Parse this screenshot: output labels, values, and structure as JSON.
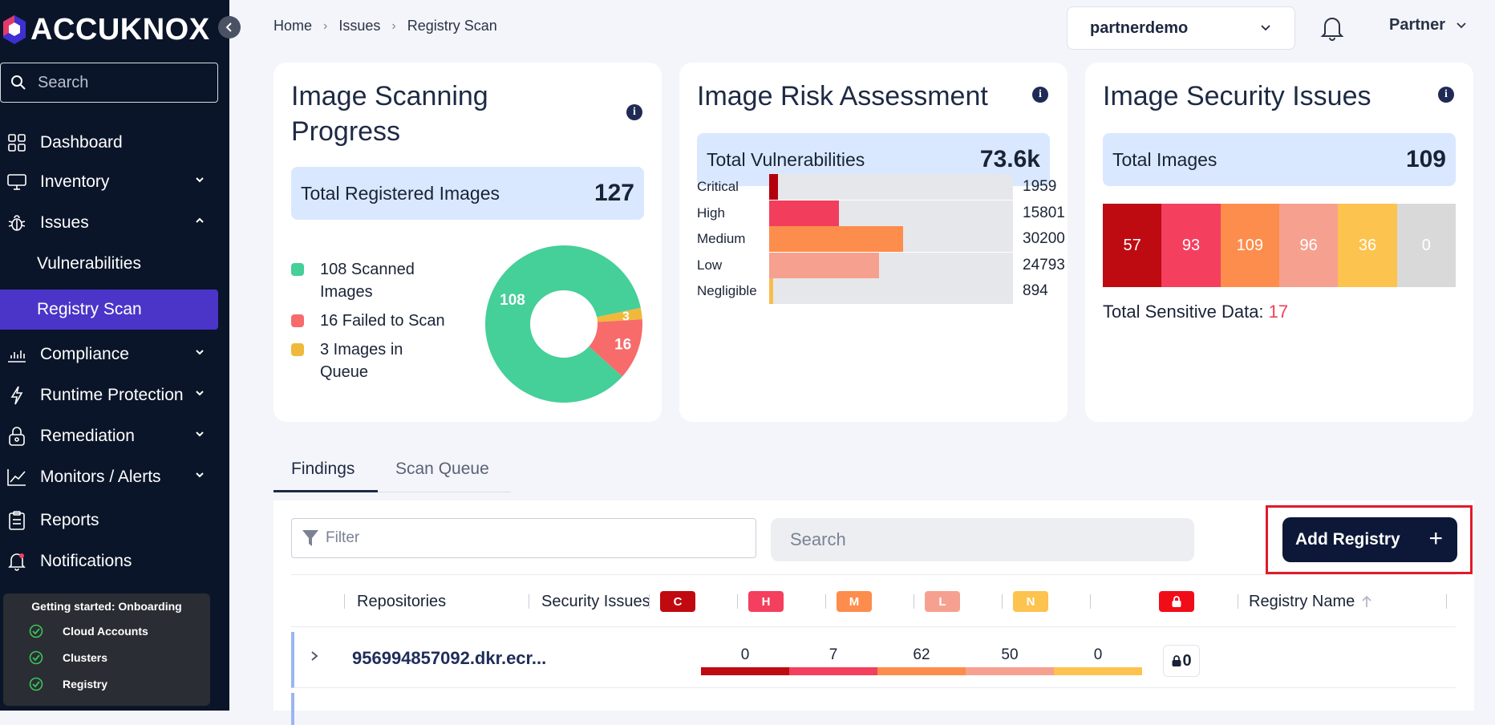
{
  "brand": {
    "name": "ACCUKNOX"
  },
  "sidebar": {
    "search_placeholder": "Search",
    "items": [
      {
        "label": "Dashboard",
        "icon": "grid-icon"
      },
      {
        "label": "Inventory",
        "icon": "monitor-icon"
      },
      {
        "label": "Issues",
        "icon": "bug-icon"
      },
      {
        "label": "Vulnerabilities"
      },
      {
        "label": "Registry Scan"
      },
      {
        "label": "Compliance",
        "icon": "chart-icon"
      },
      {
        "label": "Runtime Protection",
        "icon": "bolt-icon"
      },
      {
        "label": "Remediation",
        "icon": "lock-icon"
      },
      {
        "label": "Monitors / Alerts",
        "icon": "trend-icon"
      },
      {
        "label": "Reports",
        "icon": "clipboard-icon"
      },
      {
        "label": "Notifications",
        "icon": "bell-icon"
      }
    ],
    "onboarding": {
      "title": "Getting started: Onboarding",
      "steps": [
        "Cloud Accounts",
        "Clusters",
        "Registry"
      ]
    }
  },
  "breadcrumb": [
    "Home",
    "Issues",
    "Registry Scan"
  ],
  "header": {
    "tenant": "partnerdemo",
    "user": "Partner"
  },
  "cards": {
    "progress": {
      "title": "Image Scanning Progress",
      "stat_label": "Total Registered Images",
      "stat_value": "127",
      "legend": [
        {
          "label": "108 Scanned Images",
          "color": "#45cf99"
        },
        {
          "label": "16 Failed to Scan",
          "color": "#f76b6b"
        },
        {
          "label": "3 Images in Queue",
          "color": "#f0b93b"
        }
      ]
    },
    "risk": {
      "title": "Image Risk Assessment",
      "stat_label": "Total Vulnerabilities",
      "stat_value": "73.6k",
      "rows": [
        {
          "label": "Critical",
          "value": "1959",
          "color": "#b3000d"
        },
        {
          "label": "High",
          "value": "15801",
          "color": "#f23e5c"
        },
        {
          "label": "Medium",
          "value": "30200",
          "color": "#fd8d4c"
        },
        {
          "label": "Low",
          "value": "24793",
          "color": "#f6a190"
        },
        {
          "label": "Negligible",
          "value": "894",
          "color": "#f8bc4f"
        }
      ]
    },
    "security": {
      "title": "Image Security Issues",
      "stat_label": "Total Images",
      "stat_value": "109",
      "cells": [
        {
          "value": "57",
          "color": "#be0b12"
        },
        {
          "value": "93",
          "color": "#f43f5e"
        },
        {
          "value": "109",
          "color": "#fd8d4c"
        },
        {
          "value": "96",
          "color": "#f6a190"
        },
        {
          "value": "36",
          "color": "#fdc34f"
        },
        {
          "value": "0",
          "color": "#d9d9d9"
        }
      ],
      "sensitive_label": "Total Sensitive Data:",
      "sensitive_value": "17"
    }
  },
  "chart_data": {
    "type": "pie",
    "title": "",
    "categories": [
      "Scanned Images",
      "Failed to Scan",
      "Images in Queue"
    ],
    "values": [
      108,
      16,
      3
    ],
    "colors": [
      "#45cf99",
      "#f76b6b",
      "#f0b93b"
    ],
    "donut": true
  },
  "tabs": [
    "Findings",
    "Scan Queue"
  ],
  "table": {
    "filter_placeholder": "Filter",
    "search_placeholder": "Search",
    "add_button": "Add Registry",
    "columns": {
      "repositories": "Repositories",
      "security_issues": "Security Issues",
      "registry_name": "Registry Name",
      "severity_badges": [
        {
          "label": "C",
          "color": "#c00a10"
        },
        {
          "label": "H",
          "color": "#f43f5e"
        },
        {
          "label": "M",
          "color": "#fd8d4c"
        },
        {
          "label": "L",
          "color": "#f6a190"
        },
        {
          "label": "N",
          "color": "#fdc34f"
        }
      ]
    },
    "rows": [
      {
        "repository": "956994857092.dkr.ecr...",
        "c": "0",
        "h": "7",
        "m": "62",
        "l": "50",
        "n": "0",
        "secrets": "0"
      }
    ]
  }
}
